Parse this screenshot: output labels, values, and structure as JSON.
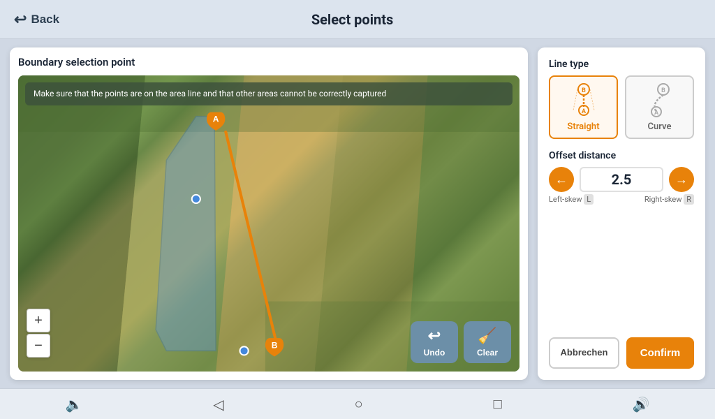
{
  "topBar": {
    "backLabel": "Back",
    "title": "Select points"
  },
  "leftPanel": {
    "title": "Boundary selection point",
    "infoBanner": "Make sure that the points are on the area line and that other areas cannot be correctly captured",
    "zoom": {
      "plusLabel": "+",
      "minusLabel": "−"
    },
    "actions": {
      "undoLabel": "Undo",
      "clearLabel": "Clear"
    }
  },
  "rightPanel": {
    "lineTypeLabel": "Line type",
    "lineTypes": [
      {
        "id": "straight",
        "label": "Straight",
        "active": true
      },
      {
        "id": "curve",
        "label": "Curve",
        "active": false
      }
    ],
    "offsetLabel": "Offset distance",
    "offsetValue": "2.5",
    "leftSkewLabel": "Left-skew",
    "leftSkewKey": "L",
    "rightSkewLabel": "Right-skew",
    "rightSkewKey": "R",
    "abbrechenLabel": "Abbrechen",
    "confirmLabel": "Confirm"
  },
  "bottomNav": {
    "icons": [
      "volume-down",
      "back",
      "circle",
      "square",
      "volume-up"
    ]
  }
}
